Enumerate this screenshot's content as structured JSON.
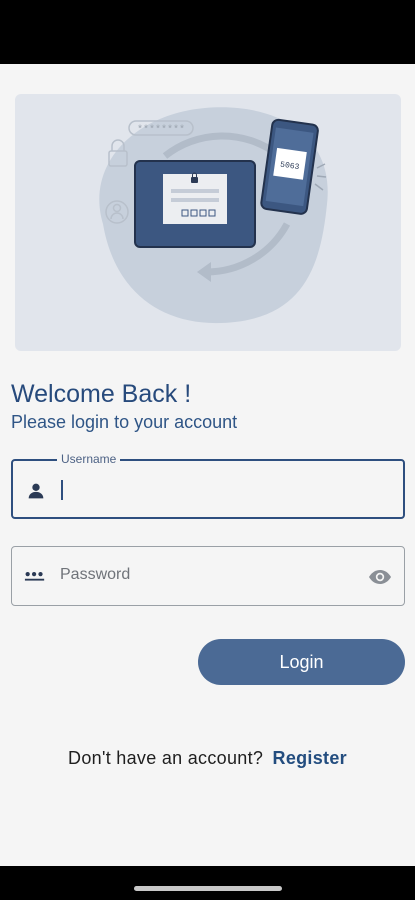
{
  "hero": {
    "illustration_icon": "login-illustration",
    "password_mask": "********",
    "otp_code": "5063"
  },
  "welcome": {
    "title": "Welcome Back !",
    "subtitle": "Please login to your account"
  },
  "username": {
    "label": "Username",
    "value": "",
    "icon": "person-icon"
  },
  "password": {
    "placeholder": "Password",
    "icon": "password-dots-icon",
    "toggle_icon": "eye-icon"
  },
  "login": {
    "label": "Login"
  },
  "register": {
    "prompt": "Don't have an account?",
    "link": "Register"
  },
  "colors": {
    "primary": "#274a7c",
    "button": "#4b6a95",
    "background": "#f5f5f5",
    "illustration_bg": "#e1e5ec"
  }
}
